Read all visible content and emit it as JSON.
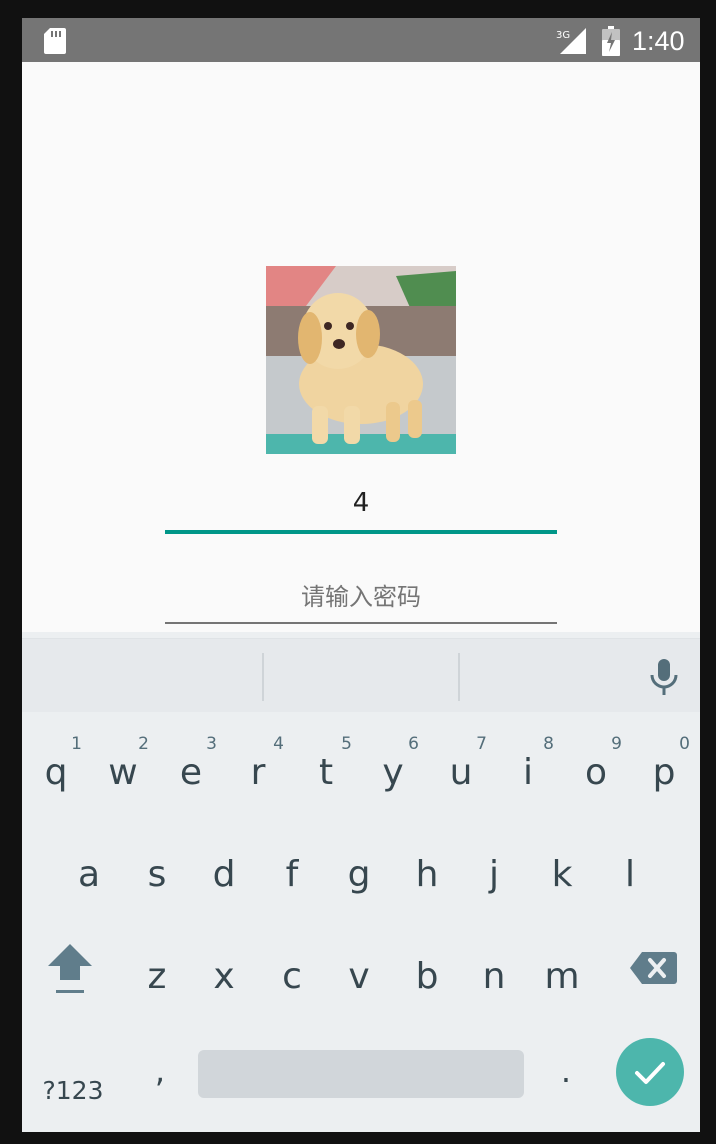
{
  "status_bar": {
    "time": "1:40",
    "network": "3G",
    "icons": [
      "sd-card-icon",
      "signal-icon",
      "battery-icon"
    ]
  },
  "login": {
    "avatar": "puppy-image",
    "username_value": "4",
    "password_placeholder": "请输入密码",
    "accent_color": "#009688"
  },
  "keyboard": {
    "row1": [
      {
        "letter": "q",
        "hint": "1"
      },
      {
        "letter": "w",
        "hint": "2"
      },
      {
        "letter": "e",
        "hint": "3"
      },
      {
        "letter": "r",
        "hint": "4"
      },
      {
        "letter": "t",
        "hint": "5"
      },
      {
        "letter": "y",
        "hint": "6"
      },
      {
        "letter": "u",
        "hint": "7"
      },
      {
        "letter": "i",
        "hint": "8"
      },
      {
        "letter": "o",
        "hint": "9"
      },
      {
        "letter": "p",
        "hint": "0"
      }
    ],
    "row2": [
      "a",
      "s",
      "d",
      "f",
      "g",
      "h",
      "j",
      "k",
      "l"
    ],
    "row3": [
      "z",
      "x",
      "c",
      "v",
      "b",
      "n",
      "m"
    ],
    "symbols_label": "?123",
    "comma_label": ",",
    "period_label": ".",
    "enter_color": "#4db6ac"
  }
}
